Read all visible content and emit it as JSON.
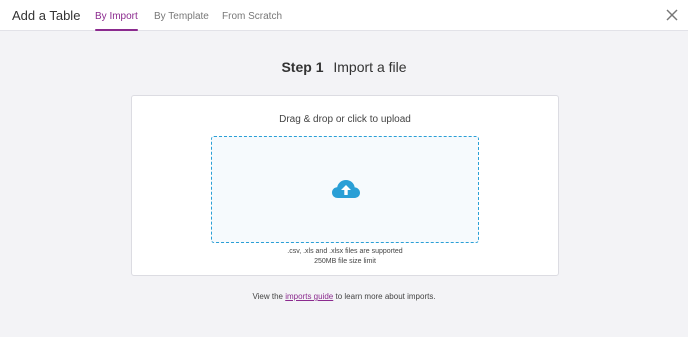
{
  "header": {
    "title": "Add a Table",
    "tabs": [
      {
        "label": "By Import",
        "active": true
      },
      {
        "label": "By Template",
        "active": false
      },
      {
        "label": "From Scratch",
        "active": false
      }
    ],
    "close_icon": "close-icon"
  },
  "main": {
    "step_number": "Step 1",
    "step_title": "Import a file",
    "upload": {
      "instruction": "Drag & drop or click to upload",
      "icon": "cloud-upload-icon",
      "formats_note": ".csv, .xls and .xlsx files are supported",
      "size_note": "250MB file size limit"
    },
    "footer": {
      "prefix": "View the",
      "link_text": "imports guide",
      "suffix": "to learn more about imports."
    }
  },
  "colors": {
    "accent": "#8b2a8e",
    "upload_blue": "#2a9fd6",
    "background": "#f3f3f6"
  }
}
